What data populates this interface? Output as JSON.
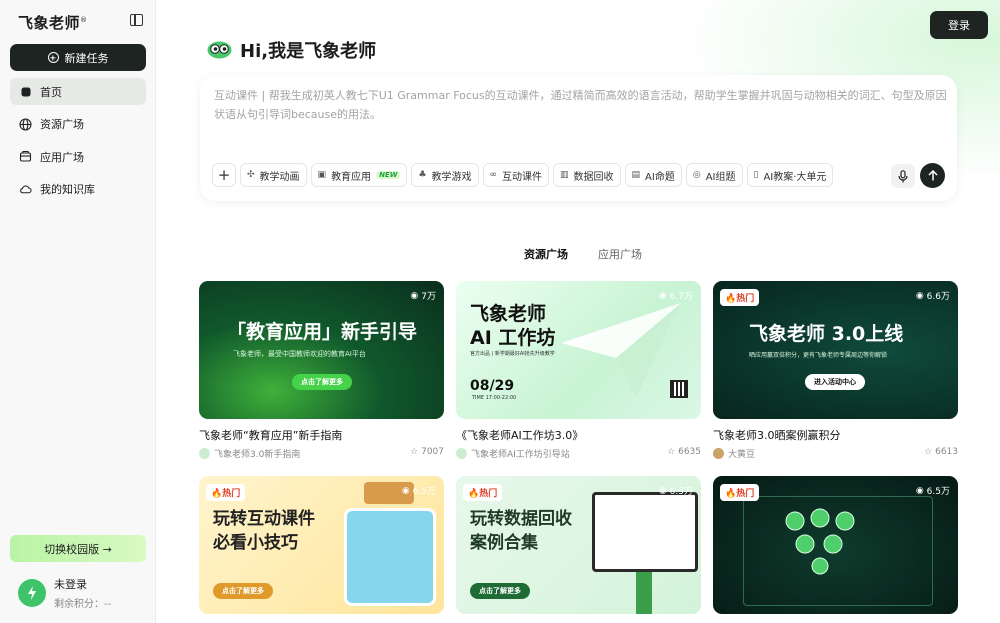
{
  "sidebar": {
    "brand": "飞象老师",
    "brand_mark": "®",
    "new_task": "新建任务",
    "items": [
      {
        "label": "首页",
        "icon": "home-icon"
      },
      {
        "label": "资源广场",
        "icon": "globe-icon"
      },
      {
        "label": "应用广场",
        "icon": "app-store-icon"
      },
      {
        "label": "我的知识库",
        "icon": "cloud-icon"
      }
    ],
    "switch_label": "切换校园版 →",
    "user": {
      "name": "未登录",
      "points": "剩余积分：--"
    }
  },
  "header": {
    "login": "登录"
  },
  "greeting": "Hi,我是飞象老师",
  "prompt": {
    "placeholder": "互动课件 | 帮我生成初英人教七下U1 Grammar Focus的互动课件，通过精简而高效的语言活动，帮助学生掌握并巩固与动物相关的词汇、句型及原因状语从句引导词because的用法。",
    "tools": [
      {
        "label": "教学动画",
        "icon": "animation-icon"
      },
      {
        "label": "教育应用",
        "icon": "apps-icon",
        "badge": "NEW"
      },
      {
        "label": "教学游戏",
        "icon": "game-icon"
      },
      {
        "label": "互动课件",
        "icon": "link-icon"
      },
      {
        "label": "数据回收",
        "icon": "chart-icon"
      },
      {
        "label": "AI命题",
        "icon": "doc-icon"
      },
      {
        "label": "AI组题",
        "icon": "compose-icon"
      },
      {
        "label": "AI教案·大单元",
        "icon": "book-icon"
      }
    ]
  },
  "tabs": [
    "资源广场",
    "应用广场"
  ],
  "cards": [
    {
      "views": "7万",
      "title": "飞象老师“教育应用”新手指南",
      "author": "飞象老师3.0新手指南",
      "stars": "7007",
      "art": {
        "title": "「教育应用」新手引导",
        "sub": "飞象老师，最受中国教师欢迎的教育AI平台",
        "btn": "点击了解更多"
      }
    },
    {
      "views": "6.7万",
      "title": "《飞象老师AI工作坊3.0》",
      "author": "飞象老师AI工作坊引导站",
      "stars": "6635",
      "art": {
        "title1": "飞象老师",
        "title2": "AI 工作坊",
        "sub": "官方出品 | 新学期最好AI抢先升级教学",
        "date": "08/29",
        "time": "TIME 17:00-22:00"
      }
    },
    {
      "hot": "热门",
      "views": "6.6万",
      "title": "飞象老师3.0晒案例赢积分",
      "author": "大黄豆",
      "stars": "6613",
      "art": {
        "title": "飞象老师 3.0上线",
        "sub": "晒应用赢双倍积分，更有飞象老师专属周边等你解锁",
        "btn": "进入活动中心"
      }
    },
    {
      "hot": "热门",
      "views": "6.5万",
      "art": {
        "title1": "玩转互动课件",
        "title2": "必看小技巧",
        "btn": "点击了解更多"
      }
    },
    {
      "hot": "热门",
      "views": "6.5万",
      "art": {
        "title1": "玩转数据回收",
        "title2": "案例合集",
        "btn": "点击了解更多"
      }
    },
    {
      "hot": "热门",
      "views": "6.5万"
    }
  ]
}
